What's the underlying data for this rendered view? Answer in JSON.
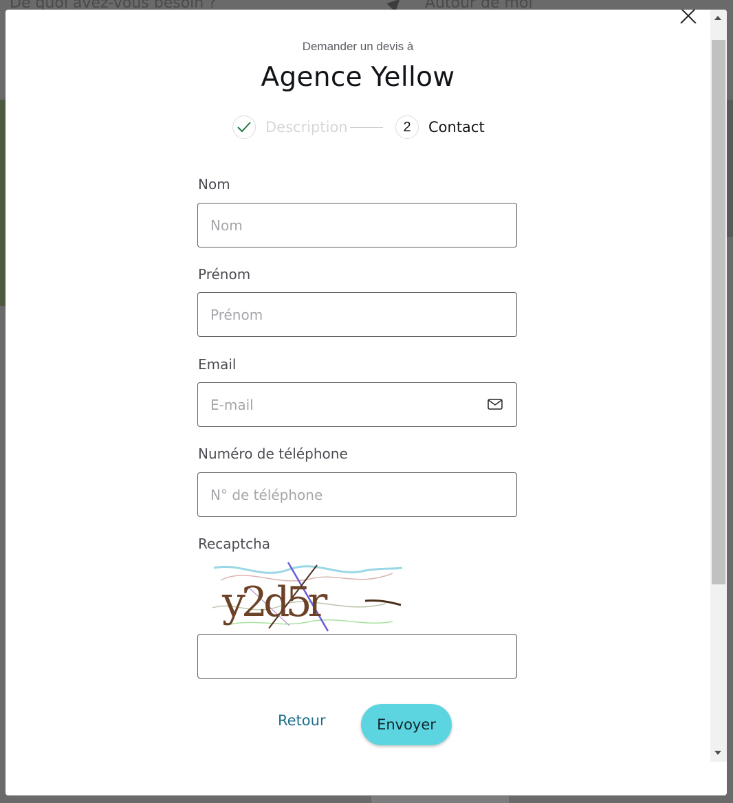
{
  "background": {
    "search_placeholder": "De quoi avez-vous besoin ?",
    "location_label": "Autour de moi"
  },
  "modal": {
    "subtitle": "Demander un devis à",
    "title": "Agence Yellow",
    "stepper": {
      "step1_label": "Description",
      "step2_number": "2",
      "step2_label": "Contact"
    },
    "fields": {
      "nom": {
        "label": "Nom",
        "placeholder": "Nom",
        "value": ""
      },
      "prenom": {
        "label": "Prénom",
        "placeholder": "Prénom",
        "value": ""
      },
      "email": {
        "label": "Email",
        "placeholder": "E-mail",
        "value": ""
      },
      "phone": {
        "label": "Numéro de téléphone",
        "placeholder": "N° de téléphone",
        "value": ""
      },
      "captcha": {
        "label": "Recaptcha",
        "image_text": "y2d5r",
        "value": ""
      }
    },
    "buttons": {
      "back": "Retour",
      "send": "Envoyer"
    },
    "colors": {
      "accent": "#5dd5e0",
      "link": "#1d6f8e",
      "check": "#1e7a4a"
    }
  }
}
